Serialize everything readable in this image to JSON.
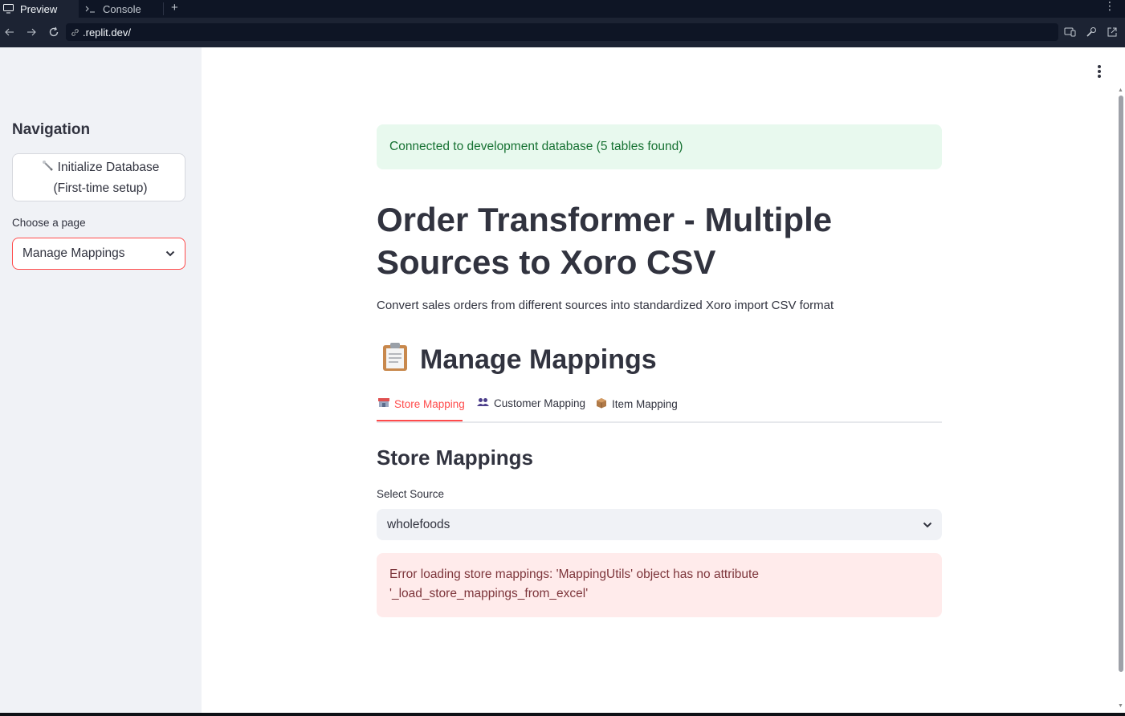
{
  "browser": {
    "tabs": [
      {
        "label": "Preview",
        "icon": "monitor-icon"
      },
      {
        "label": "Console",
        "icon": "terminal-icon"
      }
    ],
    "new_tab_icon": "plus-icon",
    "url": ".replit.dev/"
  },
  "sidebar": {
    "title": "Navigation",
    "init_button_label": "Initialize Database (First-time setup)",
    "page_select_label": "Choose a page",
    "page_select_value": "Manage Mappings"
  },
  "main": {
    "success_message": "Connected to development database (5 tables found)",
    "title": "Order Transformer - Multiple Sources to Xoro CSV",
    "subtitle": "Convert sales orders from different sources into standardized Xoro import CSV format",
    "section_title": "Manage Mappings",
    "tabs": [
      {
        "label": "Store Mapping",
        "icon": "store-icon",
        "active": true
      },
      {
        "label": "Customer Mapping",
        "icon": "people-icon",
        "active": false
      },
      {
        "label": "Item Mapping",
        "icon": "package-icon",
        "active": false
      }
    ],
    "store_heading": "Store Mappings",
    "source_label": "Select Source",
    "source_value": "wholefoods",
    "error_message": "Error loading store mappings: 'MappingUtils' object has no attribute '_load_store_mappings_from_excel'"
  },
  "colors": {
    "accent": "#ff4b4b",
    "success_bg": "#e8f9ee",
    "success_text": "#177233",
    "error_bg": "#ffebeb",
    "error_text": "#7d353b"
  }
}
